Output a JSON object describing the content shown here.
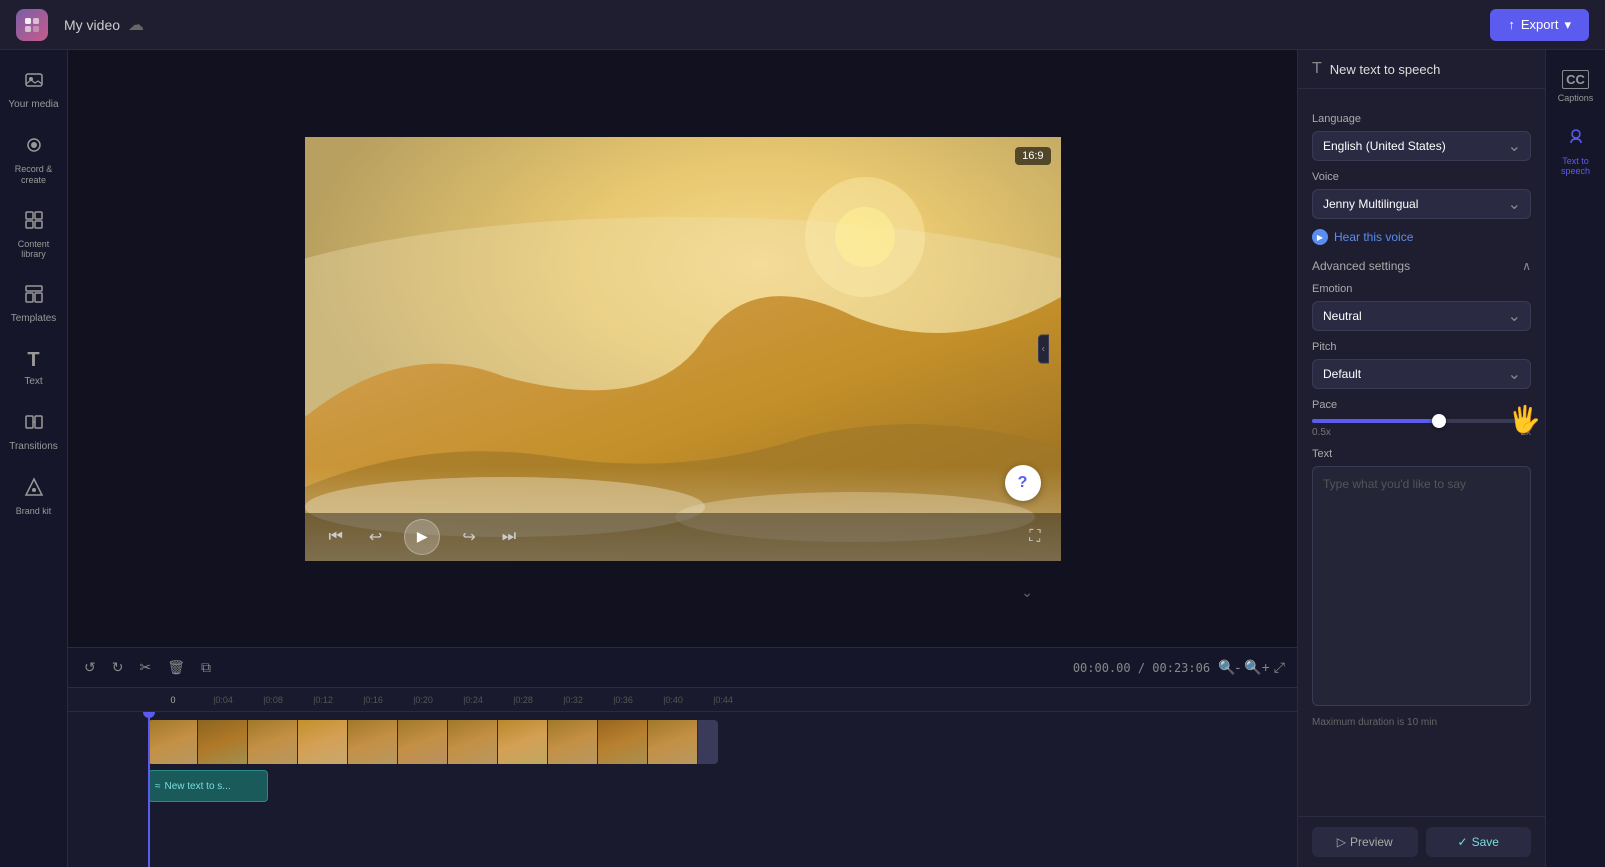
{
  "app": {
    "logo_color_start": "#7b5ea7",
    "logo_color_end": "#c45c8a"
  },
  "topbar": {
    "project_name": "My video",
    "export_label": "Export"
  },
  "left_sidebar": {
    "items": [
      {
        "id": "your-media",
        "icon": "🎬",
        "label": "Your media"
      },
      {
        "id": "record-create",
        "icon": "⬤",
        "label": "Record & create"
      },
      {
        "id": "content-library",
        "icon": "⊞",
        "label": "Content library"
      },
      {
        "id": "templates",
        "icon": "⊡",
        "label": "Templates"
      },
      {
        "id": "text",
        "icon": "T",
        "label": "Text"
      },
      {
        "id": "transitions",
        "icon": "⇄",
        "label": "Transitions"
      },
      {
        "id": "brand-kit",
        "icon": "◈",
        "label": "Brand kit"
      }
    ]
  },
  "video_preview": {
    "aspect_ratio": "16:9",
    "current_time": "00:00.00",
    "total_time": "00:23:06"
  },
  "timeline": {
    "toolbar": {
      "undo_label": "↺",
      "redo_label": "↻",
      "cut_label": "✂",
      "delete_label": "🗑",
      "duplicate_label": "⧉"
    },
    "current_time": "00:00.00 / 00:23:06",
    "ruler_marks": [
      "0",
      "|0:04",
      "|0:08",
      "|0:12",
      "|0:16",
      "|0:20",
      "|0:24",
      "|0:28",
      "|0:32",
      "|0:36",
      "|0:40",
      "|0:44"
    ]
  },
  "tts_clip": {
    "label": "New text to s..."
  },
  "right_panel": {
    "header_icon": "T",
    "header_title": "New text to speech",
    "language_label": "Language",
    "language_value": "English (United States)",
    "voice_label": "Voice",
    "voice_value": "Jenny Multilingual",
    "hear_voice_label": "Hear this voice",
    "advanced_settings_label": "Advanced settings",
    "emotion_label": "Emotion",
    "emotion_value": "Neutral",
    "pitch_label": "Pitch",
    "pitch_value": "Default",
    "pace_label": "Pace",
    "pace_min": "0.5x",
    "pace_max": "2x",
    "text_label": "Text",
    "text_placeholder": "Type what you'd like to say",
    "max_duration": "Maximum duration is 10 min",
    "preview_label": "Preview",
    "save_label": "Save"
  },
  "far_right": {
    "items": [
      {
        "id": "captions",
        "icon": "CC",
        "label": "Captions"
      },
      {
        "id": "tts",
        "icon": "🎤",
        "label": "Text to speech"
      }
    ]
  }
}
